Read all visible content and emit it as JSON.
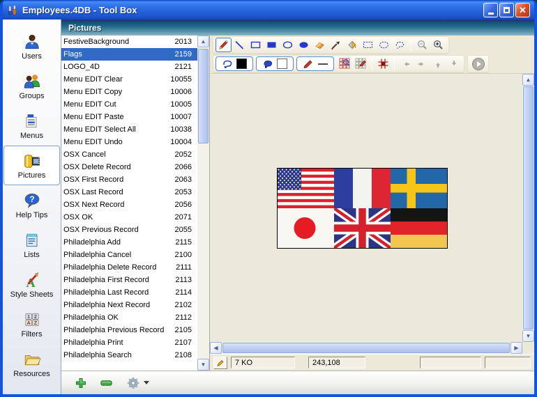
{
  "window": {
    "title": "Employees.4DB - Tool Box"
  },
  "titlebar_controls": {
    "minimize": "minimize",
    "maximize": "maximize",
    "close": "close"
  },
  "sidebar": {
    "items": [
      {
        "label": "Users",
        "selected": false
      },
      {
        "label": "Groups",
        "selected": false
      },
      {
        "label": "Menus",
        "selected": false
      },
      {
        "label": "Pictures",
        "selected": true
      },
      {
        "label": "Help Tips",
        "selected": false
      },
      {
        "label": "Lists",
        "selected": false
      },
      {
        "label": "Style Sheets",
        "selected": false
      },
      {
        "label": "Filters",
        "selected": false
      },
      {
        "label": "Resources",
        "selected": false
      }
    ]
  },
  "header": {
    "title": "Pictures"
  },
  "picture_list": {
    "items": [
      {
        "name": "FestiveBackground",
        "id": "2013",
        "selected": false
      },
      {
        "name": "Flags",
        "id": "2159",
        "selected": true
      },
      {
        "name": "LOGO_4D",
        "id": "2121",
        "selected": false
      },
      {
        "name": "Menu EDIT Clear",
        "id": "10055",
        "selected": false
      },
      {
        "name": "Menu EDIT Copy",
        "id": "10006",
        "selected": false
      },
      {
        "name": "Menu EDIT Cut",
        "id": "10005",
        "selected": false
      },
      {
        "name": "Menu EDIT Paste",
        "id": "10007",
        "selected": false
      },
      {
        "name": "Menu EDIT Select All",
        "id": "10038",
        "selected": false
      },
      {
        "name": "Menu EDIT Undo",
        "id": "10004",
        "selected": false
      },
      {
        "name": "OSX Cancel",
        "id": "2052",
        "selected": false
      },
      {
        "name": "OSX Delete Record",
        "id": "2066",
        "selected": false
      },
      {
        "name": "OSX First Record",
        "id": "2063",
        "selected": false
      },
      {
        "name": "OSX Last Record",
        "id": "2053",
        "selected": false
      },
      {
        "name": "OSX Next Record",
        "id": "2056",
        "selected": false
      },
      {
        "name": "OSX OK",
        "id": "2071",
        "selected": false
      },
      {
        "name": "OSX Previous Record",
        "id": "2055",
        "selected": false
      },
      {
        "name": "Philadelphia Add",
        "id": "2115",
        "selected": false
      },
      {
        "name": "Philadelphia Cancel",
        "id": "2100",
        "selected": false
      },
      {
        "name": "Philadelphia Delete Record",
        "id": "2111",
        "selected": false
      },
      {
        "name": "Philadelphia First Record",
        "id": "2113",
        "selected": false
      },
      {
        "name": "Philadelphia Last Record",
        "id": "2114",
        "selected": false
      },
      {
        "name": "Philadelphia Next Record",
        "id": "2102",
        "selected": false
      },
      {
        "name": "Philadelphia OK",
        "id": "2112",
        "selected": false
      },
      {
        "name": "Philadelphia Previous Record",
        "id": "2105",
        "selected": false
      },
      {
        "name": "Philadelphia Print",
        "id": "2107",
        "selected": false
      },
      {
        "name": "Philadelphia Search",
        "id": "2108",
        "selected": false
      }
    ]
  },
  "editor": {
    "selected_tool": "pencil",
    "foreground_color": "#000000",
    "background_color": "#ffffff",
    "image": {
      "name": "Flags",
      "flags": [
        "United States",
        "France",
        "Sweden",
        "Japan",
        "United Kingdom",
        "Germany"
      ]
    },
    "status": {
      "size": "7 KO",
      "dimensions": "243,108"
    }
  },
  "colors": {
    "selection_blue": "#316ac5",
    "header_teal": "#236c8d",
    "toolbar_beige": "#ece9d8",
    "canvas": "#ebe8dc",
    "titlebar_blue": "#2460da"
  }
}
